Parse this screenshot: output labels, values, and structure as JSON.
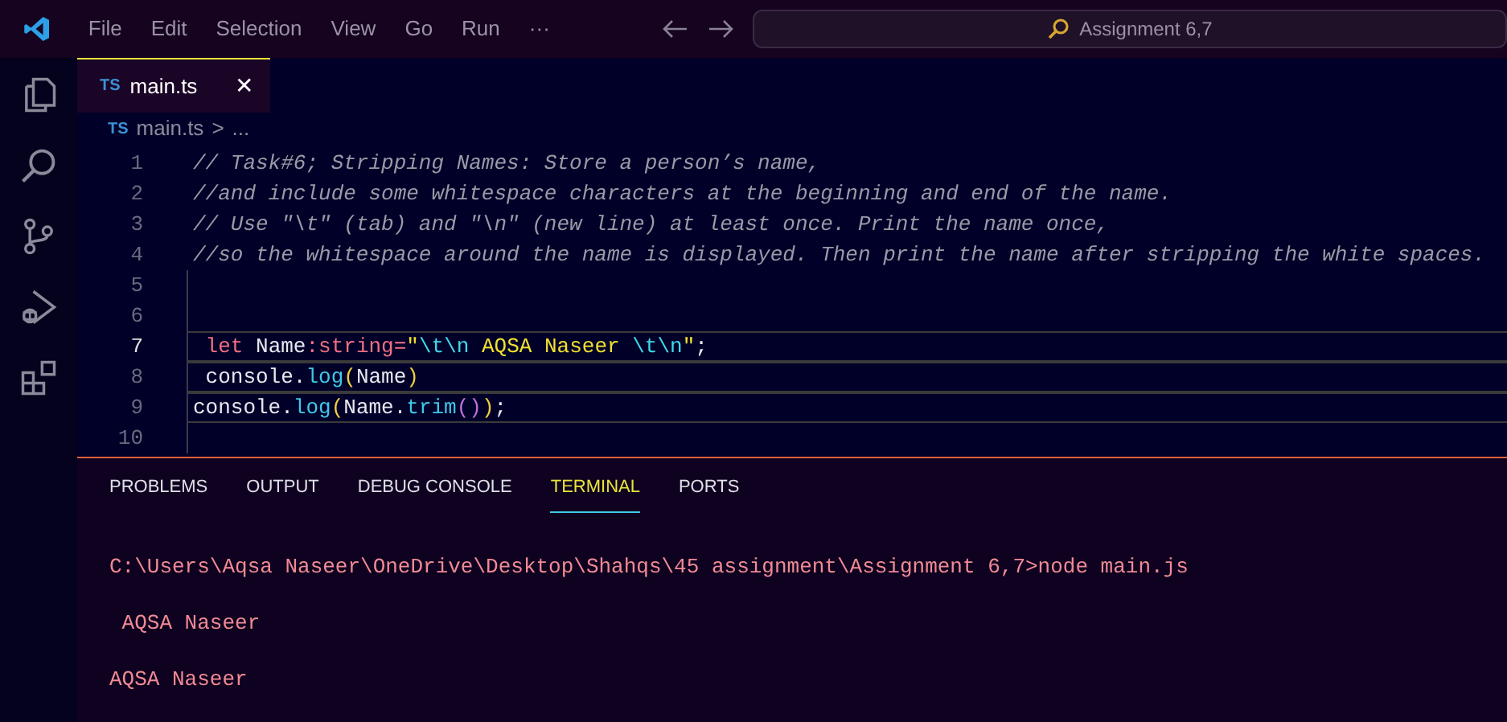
{
  "menu": [
    "File",
    "Edit",
    "Selection",
    "View",
    "Go",
    "Run",
    "···"
  ],
  "command_center": {
    "text": "Assignment 6,7"
  },
  "activity_bar": [
    {
      "kind": "files"
    },
    {
      "kind": "search"
    },
    {
      "kind": "source-control"
    },
    {
      "kind": "run-debug"
    },
    {
      "kind": "extensions"
    }
  ],
  "tabs": [
    {
      "badge": "TS",
      "label": "main.ts",
      "close": "✕",
      "selected": true
    }
  ],
  "breadcrumb": {
    "badge": "TS",
    "file": "main.ts",
    "separator": ">",
    "rest": "..."
  },
  "code_lines": [
    {
      "number": "1",
      "highlighted": false,
      "tokens": [
        {
          "kind": "comment",
          "text": "// Task#6; Stripping Names: Store a person’s name,"
        }
      ]
    },
    {
      "number": "2",
      "highlighted": false,
      "tokens": [
        {
          "kind": "comment",
          "text": "//and include some whitespace characters at the beginning and end of the name."
        }
      ]
    },
    {
      "number": "3",
      "highlighted": false,
      "tokens": [
        {
          "kind": "comment",
          "text": "// Use \"\\t\" (tab) and \"\\n\" (new line) at least once. Print the name once,"
        }
      ]
    },
    {
      "number": "4",
      "highlighted": false,
      "tokens": [
        {
          "kind": "comment",
          "text": "//so the whitespace around the name is displayed. Then print the name after stripping the white spaces."
        }
      ]
    },
    {
      "number": "5",
      "highlighted": false
    },
    {
      "number": "6",
      "highlighted": false
    },
    {
      "number": "7",
      "highlighted": true,
      "tokens": [
        {
          "kind": "keyword",
          "text": " let"
        },
        {
          "kind": "plain",
          "text": " Name"
        },
        {
          "kind": "keyword",
          "text": ":string="
        },
        {
          "kind": "string",
          "text": "\""
        },
        {
          "kind": "escape",
          "text": "\\t\\n"
        },
        {
          "kind": "string",
          "text": " AQSA Naseer "
        },
        {
          "kind": "escape",
          "text": "\\t\\n"
        },
        {
          "kind": "string",
          "text": "\""
        },
        {
          "kind": "plain",
          "text": ";"
        }
      ]
    },
    {
      "number": "8",
      "highlighted": true,
      "tokens": [
        {
          "kind": "plain",
          "text": " console."
        },
        {
          "kind": "function",
          "text": "log"
        },
        {
          "kind": "bracket",
          "text": "("
        },
        {
          "kind": "plain",
          "text": "Name"
        },
        {
          "kind": "bracket",
          "text": ")"
        }
      ]
    },
    {
      "number": "9",
      "highlighted": true,
      "tokens": [
        {
          "kind": "plain",
          "text": "console."
        },
        {
          "kind": "function",
          "text": "log"
        },
        {
          "kind": "bracket",
          "text": "("
        },
        {
          "kind": "plain",
          "text": "Name."
        },
        {
          "kind": "function",
          "text": "trim"
        },
        {
          "kind": "bracket2",
          "text": "()"
        },
        {
          "kind": "bracket",
          "text": ")"
        },
        {
          "kind": "plain",
          "text": ";"
        }
      ]
    },
    {
      "number": "10",
      "highlighted": false
    }
  ],
  "panel_tabs": [
    {
      "label": "PROBLEMS",
      "selected": false
    },
    {
      "label": "OUTPUT",
      "selected": false
    },
    {
      "label": "DEBUG CONSOLE",
      "selected": false
    },
    {
      "label": "TERMINAL",
      "selected": true
    },
    {
      "label": "PORTS",
      "selected": false
    }
  ],
  "terminal_lines": [
    "C:\\Users\\Aqsa Naseer\\OneDrive\\Desktop\\Shahqs\\45 assignment\\Assignment 6,7>node main.js",
    " AQSA Naseer",
    "AQSA Naseer"
  ]
}
